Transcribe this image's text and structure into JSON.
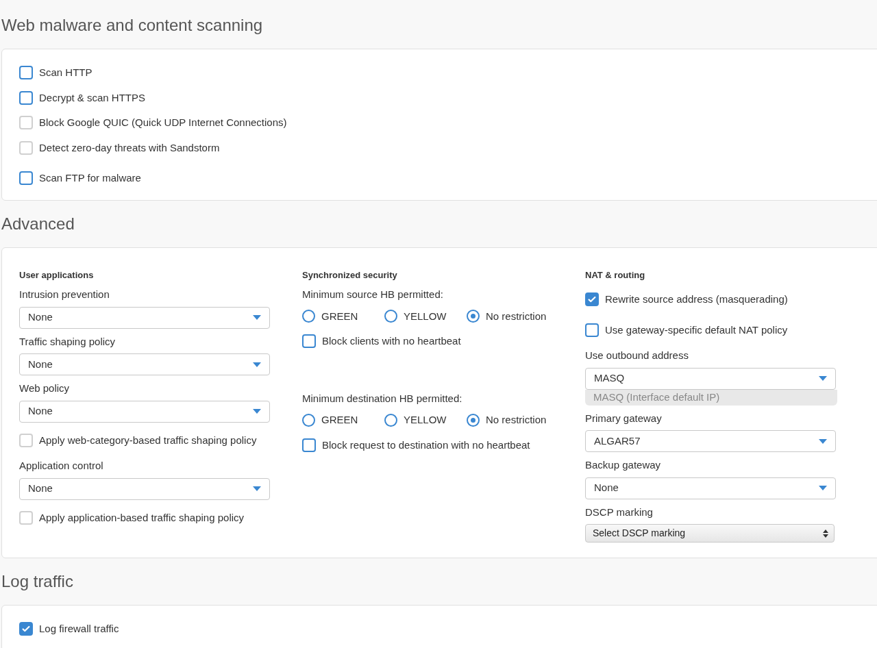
{
  "sections": [
    {
      "title": "Web malware and content scanning",
      "kind": "checklist",
      "groups": [
        [
          {
            "label": "Scan HTTP",
            "checked": false,
            "disabled": false
          },
          {
            "label": "Decrypt & scan HTTPS",
            "checked": false,
            "disabled": false
          },
          {
            "label": "Block Google QUIC (Quick UDP Internet Connections)",
            "checked": false,
            "disabled": true
          },
          {
            "label": "Detect zero-day threats with Sandstorm",
            "checked": false,
            "disabled": true
          }
        ],
        [
          {
            "label": "Scan FTP for malware",
            "checked": false,
            "disabled": false
          }
        ]
      ]
    },
    {
      "title": "Advanced",
      "kind": "columns",
      "columns": [
        {
          "heading": "User applications",
          "fields": [
            {
              "kind": "label",
              "text": "Intrusion prevention"
            },
            {
              "kind": "select",
              "value": "None"
            },
            {
              "kind": "label",
              "text": "Traffic shaping policy"
            },
            {
              "kind": "select",
              "value": "None"
            },
            {
              "kind": "label",
              "text": "Web policy"
            },
            {
              "kind": "select",
              "value": "None"
            },
            {
              "kind": "checkbox",
              "label": "Apply web-category-based traffic shaping policy",
              "checked": false,
              "disabled": true
            },
            {
              "kind": "label",
              "text": "Application control"
            },
            {
              "kind": "select",
              "value": "None"
            },
            {
              "kind": "checkbox",
              "label": "Apply application-based traffic shaping policy",
              "checked": false,
              "disabled": true
            }
          ]
        },
        {
          "heading": "Synchronized security",
          "fields": [
            {
              "kind": "label",
              "text": "Minimum source HB permitted:"
            },
            {
              "kind": "radios",
              "options": [
                {
                  "label": "GREEN",
                  "selected": false
                },
                {
                  "label": "YELLOW",
                  "selected": false
                },
                {
                  "label": "No restriction",
                  "selected": true
                }
              ]
            },
            {
              "kind": "checkbox",
              "label": "Block clients with no heartbeat",
              "checked": false,
              "disabled": false
            },
            {
              "kind": "gap"
            },
            {
              "kind": "label",
              "text": "Minimum destination HB permitted:"
            },
            {
              "kind": "radios",
              "options": [
                {
                  "label": "GREEN",
                  "selected": false
                },
                {
                  "label": "YELLOW",
                  "selected": false
                },
                {
                  "label": "No restriction",
                  "selected": true
                }
              ]
            },
            {
              "kind": "checkbox",
              "label": "Block request to destination with no heartbeat",
              "checked": false,
              "disabled": false
            }
          ]
        },
        {
          "heading": "NAT & routing",
          "fields": [
            {
              "kind": "checkbox",
              "label": "Rewrite source address (masquerading)",
              "checked": true,
              "disabled": false
            },
            {
              "kind": "checkbox",
              "label": "Use gateway-specific default NAT policy",
              "checked": false,
              "disabled": false
            },
            {
              "kind": "label",
              "text": "Use outbound address"
            },
            {
              "kind": "select",
              "value": "MASQ",
              "hint": "MASQ (Interface default IP)"
            },
            {
              "kind": "label",
              "text": "Primary gateway"
            },
            {
              "kind": "select",
              "value": "ALGAR57"
            },
            {
              "kind": "label",
              "text": "Backup gateway"
            },
            {
              "kind": "select",
              "value": "None"
            },
            {
              "kind": "label",
              "text": "DSCP marking"
            },
            {
              "kind": "native_select",
              "value": "Select DSCP marking"
            }
          ]
        }
      ]
    },
    {
      "title": "Log traffic",
      "kind": "checklist",
      "groups": [
        [
          {
            "label": "Log firewall traffic",
            "checked": true,
            "disabled": false
          }
        ]
      ]
    }
  ]
}
